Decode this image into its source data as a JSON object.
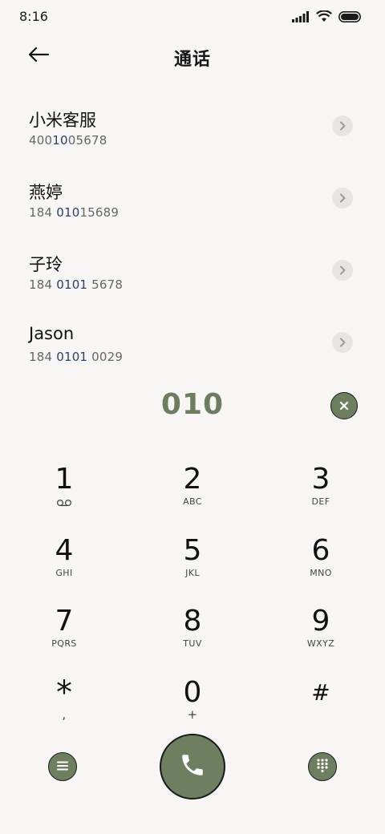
{
  "status_bar": {
    "time": "8:16"
  },
  "header": {
    "title": "通话"
  },
  "contacts": [
    {
      "name": "小米客服",
      "number_pre": "400",
      "number_hl": "10",
      "number_post": "05678"
    },
    {
      "name": "燕婷",
      "number_pre": "184 ",
      "number_hl": "010",
      "number_post": "15689"
    },
    {
      "name": "子玲",
      "number_pre": "184 ",
      "number_hl": "0101",
      "number_post": " 5678"
    },
    {
      "name": "Jason",
      "number_pre": "184 ",
      "number_hl": "0101",
      "number_post": " 0029"
    }
  ],
  "dial_input": {
    "value": "010"
  },
  "keypad": [
    {
      "digit": "1",
      "letters": ""
    },
    {
      "digit": "2",
      "letters": "ABC"
    },
    {
      "digit": "3",
      "letters": "DEF"
    },
    {
      "digit": "4",
      "letters": "GHI"
    },
    {
      "digit": "5",
      "letters": "JKL"
    },
    {
      "digit": "6",
      "letters": "MNO"
    },
    {
      "digit": "7",
      "letters": "PQRS"
    },
    {
      "digit": "8",
      "letters": "TUV"
    },
    {
      "digit": "9",
      "letters": "WXYZ"
    },
    {
      "digit": "*",
      "letters": ","
    },
    {
      "digit": "0",
      "letters": "+"
    },
    {
      "digit": "#",
      "letters": ""
    }
  ],
  "colors": {
    "accent": "#6e7f60",
    "background": "#f7f6f4",
    "highlight": "#2c3f6a"
  },
  "icons": {
    "back": "arrow-left-icon",
    "delete": "close-icon",
    "menu": "menu-icon",
    "call": "phone-icon",
    "dialpad": "dialpad-icon",
    "voicemail": "voicemail-icon"
  }
}
